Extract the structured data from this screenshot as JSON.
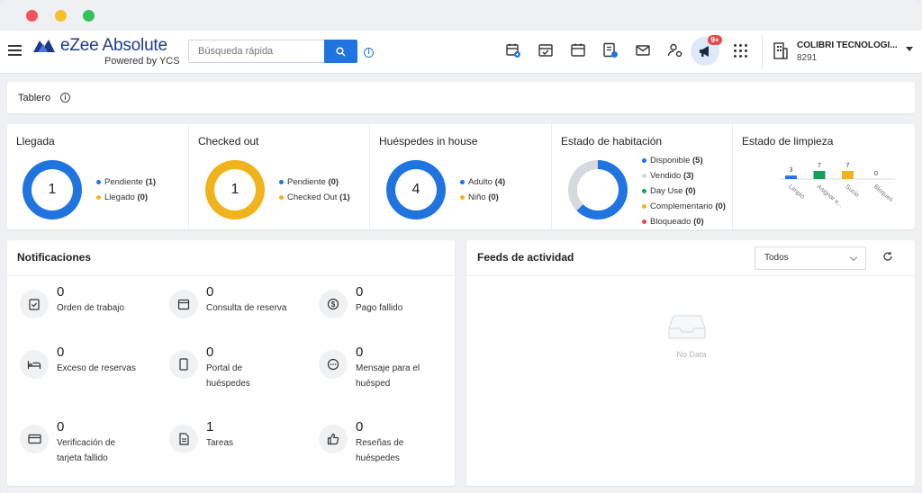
{
  "app": {
    "logo_name": "eZee Absolute",
    "logo_sub": "Powered by YCS",
    "search_placeholder": "Búsqueda rápida",
    "notification_badge": "9+",
    "hotel_name": "COLIBRI TECNOLOGI...",
    "hotel_code": "8291",
    "nav_icons": [
      "calendar-plus-icon",
      "calendar-check-icon",
      "calendar-icon",
      "invoice-icon",
      "mail-icon",
      "user-settings-icon",
      "bullhorn-icon",
      "apps-grid-icon"
    ]
  },
  "colors": {
    "accent": "#1f74e0",
    "pending": "#1f74e0",
    "arrived": "#f0b31b",
    "available": "#1f74e0",
    "sold": "#d5d8dc",
    "day_use": "#13a05a",
    "complementary": "#f0b31b",
    "blocked": "#e24b4b"
  },
  "page": {
    "title": "Tablero"
  },
  "stats": {
    "llegada": {
      "title": "Llegada",
      "value": "1",
      "legend": [
        {
          "label": "Pendiente",
          "count": "(1)"
        },
        {
          "label": "Llegado",
          "count": "(0)"
        }
      ]
    },
    "checked_out": {
      "title": "Checked out",
      "value": "1",
      "legend": [
        {
          "label": "Pendiente",
          "count": "(0)"
        },
        {
          "label": "Checked Out",
          "count": "(1)"
        }
      ]
    },
    "huespedes": {
      "title": "Huéspedes in house",
      "value": "4",
      "legend": [
        {
          "label": "Adulto",
          "count": "(4)"
        },
        {
          "label": "Niño",
          "count": "(0)"
        }
      ]
    },
    "habitacion": {
      "title": "Estado de habitación",
      "legend": [
        {
          "label": "Disponible",
          "count": "(5)"
        },
        {
          "label": "Vendido",
          "count": "(3)"
        },
        {
          "label": "Day Use",
          "count": "(0)"
        },
        {
          "label": "Complementario",
          "count": "(0)"
        },
        {
          "label": "Bloqueado",
          "count": "(0)"
        }
      ]
    },
    "limpieza": {
      "title": "Estado de limpieza"
    }
  },
  "chart_data": {
    "type": "bar",
    "categories": [
      "Limpio",
      "Asignar e...",
      "Sucio",
      "Bloqueo"
    ],
    "values": [
      3,
      7,
      7,
      0
    ],
    "colors": [
      "#1f74e0",
      "#13a05a",
      "#f0b31b",
      "#e24b4b"
    ],
    "title": "",
    "xlabel": "",
    "ylabel": ""
  },
  "notifications": {
    "title": "Notificaciones",
    "items": [
      {
        "count": "0",
        "label": "Orden de trabajo",
        "icon": "clipboard-check-icon"
      },
      {
        "count": "0",
        "label": "Consulta de reserva",
        "icon": "calendar-icon"
      },
      {
        "count": "0",
        "label": "Pago fallido",
        "icon": "dollar-icon"
      },
      {
        "count": "0",
        "label": "Exceso de reservas",
        "icon": "bed-icon"
      },
      {
        "count": "0",
        "label": "Portal de huéspedes",
        "icon": "tablet-icon"
      },
      {
        "count": "0",
        "label": "Mensaje para el huésped",
        "icon": "chat-icon"
      },
      {
        "count": "0",
        "label": "Verificación de tarjeta fallido",
        "icon": "credit-card-icon"
      },
      {
        "count": "1",
        "label": "Tareas",
        "icon": "document-icon"
      },
      {
        "count": "0",
        "label": "Reseñas de huéspedes",
        "icon": "thumbs-up-icon"
      }
    ]
  },
  "feeds": {
    "title": "Feeds de actividad",
    "filter_value": "Todos",
    "empty_text": "No Data"
  }
}
